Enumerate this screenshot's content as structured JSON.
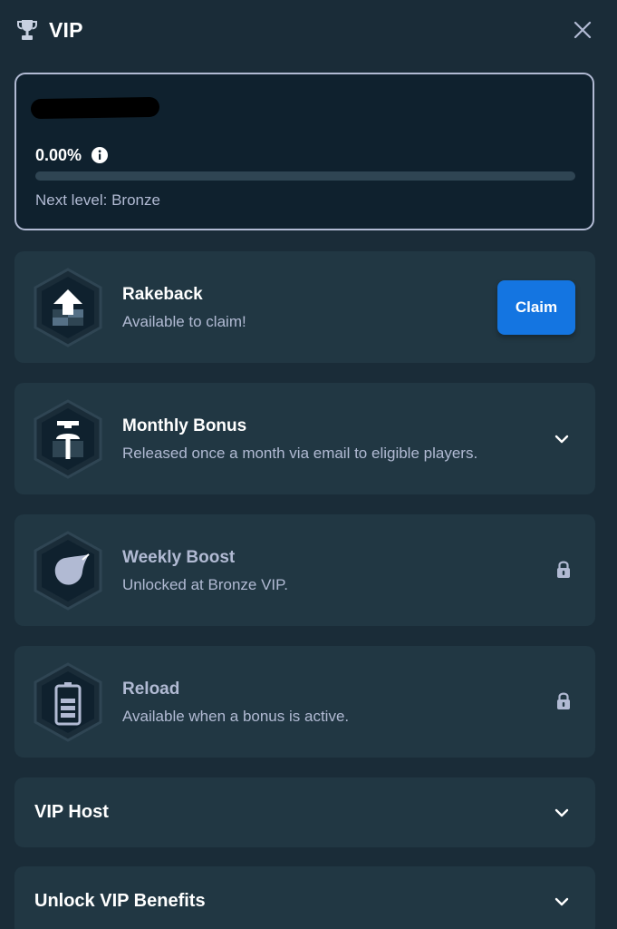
{
  "header": {
    "title": "VIP",
    "trophy_icon": "trophy-icon",
    "close_icon": "close-icon"
  },
  "progress": {
    "percent_text": "0.00%",
    "percent_value": 0,
    "next_level_text": "Next level: Bronze",
    "info_icon": "info-icon"
  },
  "rewards": [
    {
      "title": "Rakeback",
      "subtitle": "Available to claim!",
      "action": "Claim",
      "icon": "rakeback-badge-icon"
    },
    {
      "title": "Monthly Bonus",
      "subtitle": "Released once a month via email to eligible players.",
      "icon": "monthly-bonus-badge-icon"
    },
    {
      "title": "Weekly Boost",
      "subtitle": "Unlocked at Bronze VIP.",
      "icon": "weekly-boost-badge-icon",
      "locked": true
    },
    {
      "title": "Reload",
      "subtitle": "Available when a bonus is active.",
      "icon": "reload-badge-icon",
      "locked": true
    }
  ],
  "sections": [
    {
      "label": "VIP Host"
    },
    {
      "label": "Unlock VIP Benefits"
    }
  ],
  "colors": {
    "background": "#1a2c38",
    "card": "#213743",
    "progress_card": "#0f212e",
    "accent_blue": "#1475e1",
    "muted_text": "#b1bad3"
  }
}
